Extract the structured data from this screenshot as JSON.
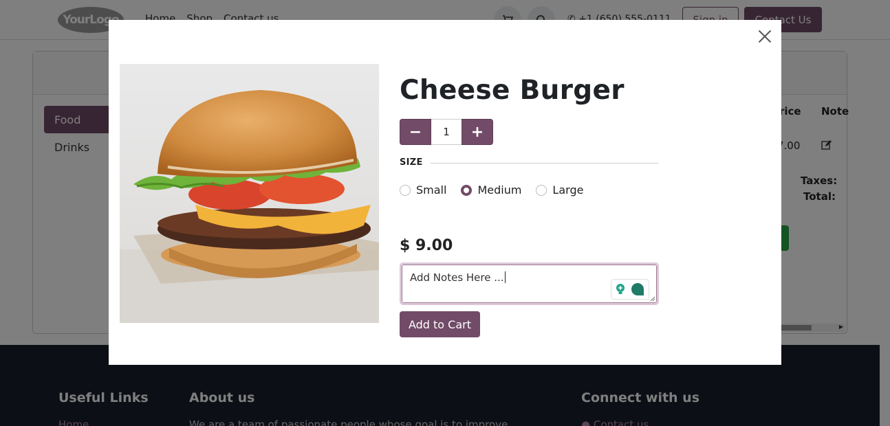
{
  "background": {
    "header": {
      "logo_text": "YourLogo",
      "nav": [
        "Home",
        "Shop",
        "Contact us"
      ],
      "cart_icon": "cart-icon",
      "search_icon": "search-icon",
      "phone": "+1 (650) 555-0111",
      "sign_in_label": "Sign in",
      "contact_label": "Contact Us"
    },
    "categories": [
      "Food",
      "Drinks"
    ],
    "table": {
      "headers": [
        "Price",
        "Note"
      ],
      "row": {
        "price": "7.00"
      },
      "taxes_label": "Taxes:",
      "total_label": "Total:"
    },
    "footer": {
      "useful_links_title": "Useful Links",
      "useful_links": [
        "Home"
      ],
      "about_title": "About us",
      "about_text": "We are a team of passionate people whose goal is to improve",
      "connect_title": "Connect with us",
      "connect_link": "Contact us"
    }
  },
  "modal": {
    "title": "Cheese Burger",
    "quantity": "1",
    "minus_label": "−",
    "plus_label": "+",
    "size_label": "SIZE",
    "sizes": [
      "Small",
      "Medium",
      "Large"
    ],
    "selected_size": "Medium",
    "price": "$ 9.00",
    "notes_value": "Add Notes Here ...",
    "add_to_cart_label": "Add to Cart"
  },
  "colors": {
    "accent": "#714b67",
    "footer_bg": "#1a1e2e",
    "success": "#28a745"
  }
}
